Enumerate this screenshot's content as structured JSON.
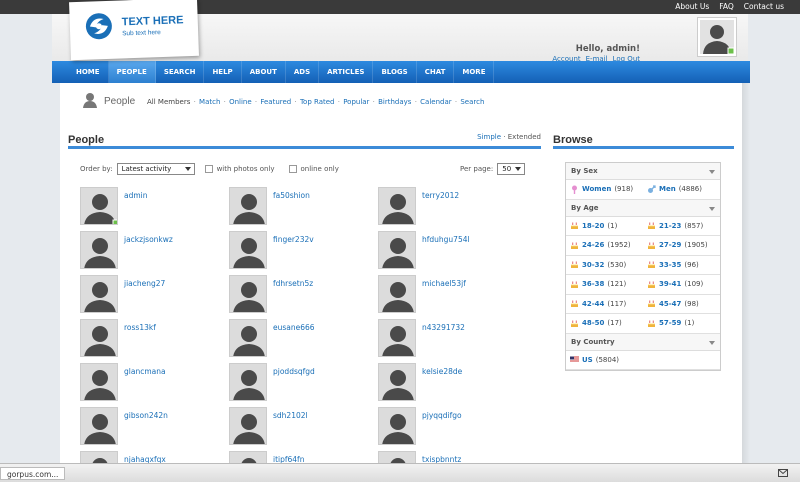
{
  "top_links": [
    "About Us",
    "FAQ",
    "Contact us"
  ],
  "logo": {
    "title": "TEXT HERE",
    "subtitle": "Sub text here"
  },
  "user": {
    "greeting": "Hello, admin!",
    "links": [
      "Account",
      "E-mail",
      "Log Out"
    ]
  },
  "nav": [
    {
      "label": "HOME",
      "active": false
    },
    {
      "label": "PEOPLE",
      "active": true
    },
    {
      "label": "SEARCH",
      "active": false
    },
    {
      "label": "HELP",
      "active": false
    },
    {
      "label": "ABOUT",
      "active": false
    },
    {
      "label": "ADS",
      "active": false
    },
    {
      "label": "ARTICLES",
      "active": false
    },
    {
      "label": "BLOGS",
      "active": false
    },
    {
      "label": "CHAT",
      "active": false
    },
    {
      "label": "MORE",
      "active": false
    }
  ],
  "page": {
    "title": "People",
    "subnav_static": "All Members",
    "subnav_links": [
      "Match",
      "Online",
      "Featured",
      "Top Rated",
      "Popular",
      "Birthdays",
      "Calendar",
      "Search"
    ]
  },
  "people": {
    "heading": "People",
    "view_simple": "Simple",
    "view_extended": "Extended",
    "order_label": "Order by:",
    "order_value": "Latest activity",
    "with_photos_label": "with photos only",
    "online_label": "online only",
    "per_page_label": "Per page:",
    "per_page_value": "50",
    "members": [
      {
        "name": "admin",
        "online": true
      },
      {
        "name": "fa50shion",
        "online": false
      },
      {
        "name": "terry2012",
        "online": false
      },
      {
        "name": "jackzjsonkwz",
        "online": false
      },
      {
        "name": "finger232v",
        "online": false
      },
      {
        "name": "hfduhgu754l",
        "online": false
      },
      {
        "name": "jiacheng27",
        "online": false
      },
      {
        "name": "fdhrsetn5z",
        "online": false
      },
      {
        "name": "michael53jf",
        "online": false
      },
      {
        "name": "ross13kf",
        "online": false
      },
      {
        "name": "eusane666",
        "online": false
      },
      {
        "name": "n43291732",
        "online": false
      },
      {
        "name": "glancmana",
        "online": false
      },
      {
        "name": "pjoddsqfgd",
        "online": false
      },
      {
        "name": "kelsie28de",
        "online": false
      },
      {
        "name": "gibson242n",
        "online": false
      },
      {
        "name": "sdh2102l",
        "online": false
      },
      {
        "name": "pjyqqdifgo",
        "online": false
      },
      {
        "name": "njahaqxfqx",
        "online": false
      },
      {
        "name": "itipf64fn",
        "online": false
      },
      {
        "name": "txispbnntz",
        "online": false
      }
    ]
  },
  "browse": {
    "heading": "Browse",
    "by_sex": {
      "title": "By Sex",
      "items": [
        {
          "label": "Women",
          "count": "(918)"
        },
        {
          "label": "Men",
          "count": "(4886)"
        }
      ]
    },
    "by_age": {
      "title": "By Age",
      "items": [
        {
          "label": "18-20",
          "count": "(1)"
        },
        {
          "label": "21-23",
          "count": "(857)"
        },
        {
          "label": "24-26",
          "count": "(1952)"
        },
        {
          "label": "27-29",
          "count": "(1905)"
        },
        {
          "label": "30-32",
          "count": "(530)"
        },
        {
          "label": "33-35",
          "count": "(96)"
        },
        {
          "label": "36-38",
          "count": "(121)"
        },
        {
          "label": "39-41",
          "count": "(109)"
        },
        {
          "label": "42-44",
          "count": "(117)"
        },
        {
          "label": "45-47",
          "count": "(98)"
        },
        {
          "label": "48-50",
          "count": "(17)"
        },
        {
          "label": "57-59",
          "count": "(1)"
        }
      ]
    },
    "by_country": {
      "title": "By Country",
      "items": [
        {
          "label": "US",
          "count": "(5804)"
        }
      ]
    }
  },
  "status": {
    "url": "gorpus.com..."
  },
  "colors": {
    "accent": "#1a6fb7",
    "nav_top": "#2d8ae0",
    "nav_bottom": "#1460b5",
    "online": "#6cc04a"
  }
}
